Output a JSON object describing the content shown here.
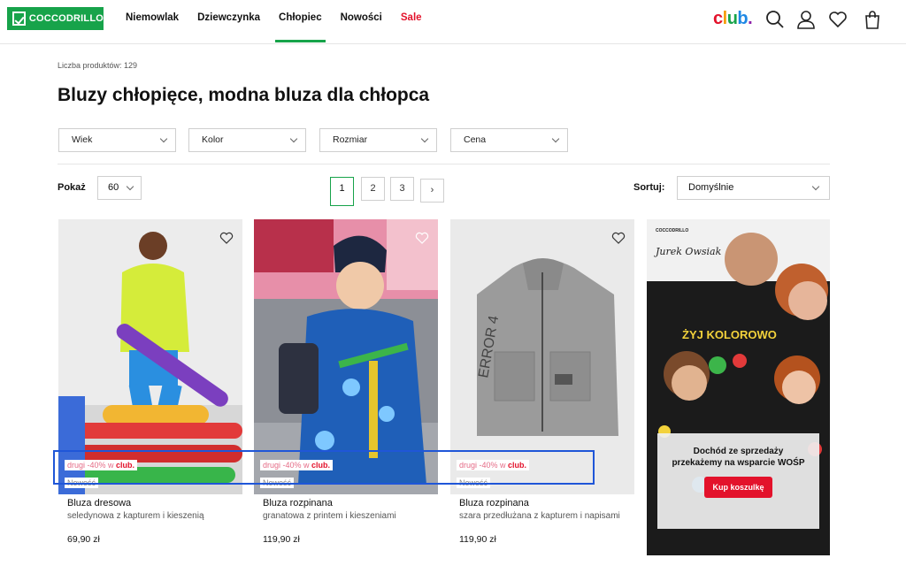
{
  "header": {
    "logo_text": "COCCODRILLO",
    "nav": [
      "Niemowlak",
      "Dziewczynka",
      "Chłopiec",
      "Nowości",
      "Sale"
    ],
    "club": [
      "c",
      "l",
      "u",
      "b",
      "."
    ]
  },
  "listing": {
    "count_text": "Liczba produktów: 129",
    "title": "Bluzy chłopięce, modna bluza dla chłopca",
    "filters": [
      "Wiek",
      "Kolor",
      "Rozmiar",
      "Cena"
    ],
    "show_label": "Pokaż",
    "show_value": "60",
    "pages": [
      "1",
      "2",
      "3"
    ],
    "next_page": "›",
    "sort_label": "Sortuj:",
    "sort_value": "Domyślnie"
  },
  "products": [
    {
      "promo_prefix": "drugi -40% w ",
      "promo_brand": "club.",
      "badge": "Nowość",
      "name": "Bluza dresowa",
      "desc": "seledynowa z kapturem i kieszenią",
      "price": "69,90 zł"
    },
    {
      "promo_prefix": "drugi -40% w ",
      "promo_brand": "club.",
      "badge": "Nowość",
      "name": "Bluza rozpinana",
      "desc": "granatowa z printem i kieszeniami",
      "price": "119,90 zł"
    },
    {
      "promo_prefix": "drugi -40% w ",
      "promo_brand": "club.",
      "badge": "Nowość",
      "name": "Bluza rozpinana",
      "desc": "szara przedłużana z kapturem i napisami",
      "price": "119,90 zł"
    }
  ],
  "banner": {
    "brand_top": "COCCODRILLO",
    "signature": "Jurek Owsiak",
    "shirt_text": "ŻYJ KOLOROWO",
    "text": "Dochód ze sprzedaży przekażemy na wsparcie WOŚP",
    "button": "Kup koszulkę"
  },
  "colors": {
    "brand_green": "#17a34a",
    "sale_red": "#e3122b",
    "highlight_blue": "#1f56d8"
  }
}
